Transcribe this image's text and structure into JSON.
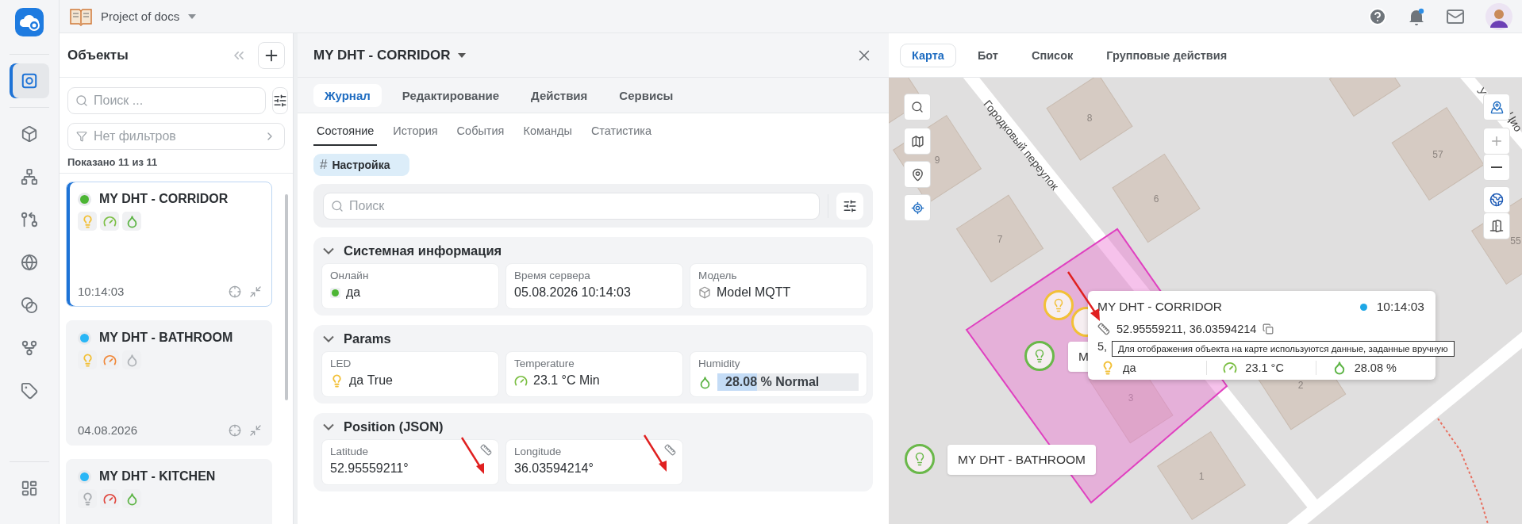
{
  "topbar": {
    "project": "Project of docs"
  },
  "rail": {
    "top": [
      {
        "selected": true
      }
    ],
    "main": [
      {
        "selected": false
      },
      {
        "selected": false
      },
      {
        "selected": false
      },
      {
        "selected": false
      },
      {
        "selected": false
      },
      {
        "selected": false
      },
      {
        "selected": false
      }
    ],
    "bottom": [
      {
        "selected": false
      }
    ]
  },
  "objects_panel": {
    "title": "Объекты",
    "search": {
      "placeholder": "Поиск ..."
    },
    "filter": "Нет фильтров",
    "count": "Показано 11 из 11",
    "items": [
      {
        "name": "MY DHT - CORRIDOR",
        "color": "#4cb534",
        "selected": true,
        "time": "10:14:03",
        "sensors": [
          {
            "kind": "led",
            "color": "#f2c037"
          },
          {
            "kind": "gauge",
            "color": "#7cbf45"
          },
          {
            "kind": "drop",
            "color": "#5fb548"
          }
        ]
      },
      {
        "name": "MY DHT - BATHROOM",
        "color": "#29b6f6",
        "selected": false,
        "time": "04.08.2026",
        "sensors": [
          {
            "kind": "led",
            "color": "#f2c037"
          },
          {
            "kind": "gauge",
            "color": "#f0883a"
          },
          {
            "kind": "drop",
            "color": "#b0b4b8"
          }
        ]
      },
      {
        "name": "MY DHT - KITCHEN",
        "color": "#29b6f6",
        "selected": false,
        "sensors": [
          {
            "kind": "led",
            "color": "#a8acb0"
          },
          {
            "kind": "gauge",
            "color": "#e0463e"
          },
          {
            "kind": "drop",
            "color": "#5fb548"
          }
        ]
      }
    ]
  },
  "detail": {
    "title": "MY DHT - CORRIDOR",
    "tabs": [
      {
        "label": "Журнал",
        "selected": true
      },
      {
        "label": "Редактирование",
        "selected": false
      },
      {
        "label": "Действия",
        "selected": false
      },
      {
        "label": "Сервисы",
        "selected": false
      }
    ],
    "subtabs": [
      {
        "label": "Состояние",
        "selected": true
      },
      {
        "label": "История",
        "selected": false
      },
      {
        "label": "События",
        "selected": false
      },
      {
        "label": "Команды",
        "selected": false
      },
      {
        "label": "Статистика",
        "selected": false
      }
    ],
    "tag": {
      "symbol": "#",
      "label": "Настройка"
    },
    "search": {
      "placeholder": "Поиск"
    },
    "sections": [
      {
        "title": "Системная информация",
        "expanded": true,
        "fields": [
          {
            "kind": "status",
            "label": "Онлайн",
            "value": "да",
            "color": "#4cb534"
          },
          {
            "kind": "text",
            "label": "Время сервера",
            "value": "05.08.2026 10:14:03"
          },
          {
            "kind": "model",
            "label": "Модель",
            "value": "Model MQTT"
          }
        ]
      },
      {
        "title": "Params",
        "expanded": true,
        "fields": [
          {
            "kind": "led",
            "label": "LED",
            "value": "да True",
            "color": "#f2c037"
          },
          {
            "kind": "gauge",
            "label": "Temperature",
            "value": "23.1 °C Min",
            "color": "#7cbf45"
          },
          {
            "kind": "meter",
            "label": "Humidity",
            "value": "28.08 % Normal",
            "color": "#5fb548",
            "level": 0.28
          }
        ]
      },
      {
        "title": "Position (JSON)",
        "expanded": true,
        "fields": [
          {
            "kind": "manual",
            "label": "Latitude",
            "value": "52.95559211°"
          },
          {
            "kind": "manual",
            "label": "Longitude",
            "value": "36.03594214°"
          }
        ]
      }
    ]
  },
  "map": {
    "tabs": [
      {
        "label": "Карта",
        "selected": true
      },
      {
        "label": "Бот",
        "selected": false
      },
      {
        "label": "Список",
        "selected": false
      },
      {
        "label": "Групповые действия",
        "selected": false
      }
    ],
    "streets": [
      {
        "text": "Городковый переулок"
      },
      {
        "text": "У"
      },
      {
        "text": "Цио"
      }
    ],
    "buildings": [
      {
        "number": "8"
      },
      {
        "number": "9"
      },
      {
        "number": "6"
      },
      {
        "number": "7"
      },
      {
        "number": "57"
      },
      {
        "number": "55"
      },
      {
        "number": "3"
      },
      {
        "number": "2"
      },
      {
        "number": "1"
      }
    ],
    "markers": [
      {
        "color": "#f2c037"
      },
      {
        "color": "#f2c037"
      },
      {
        "color": "#6ab84a",
        "label": "M"
      },
      {
        "color": "#6ab84a",
        "label": "MY DHT - BATHROOM"
      }
    ],
    "popup": {
      "title": "MY DHT - CORRIDOR",
      "color": "#1ea7e6",
      "time": "10:14:03",
      "coords": "52.95559211, 36.03594214",
      "partial": "5,",
      "values": [
        {
          "kind": "led",
          "color": "#f2c037",
          "value": "да"
        },
        {
          "kind": "gauge",
          "color": "#7cbf45",
          "value": "23.1 °C"
        },
        {
          "kind": "drop",
          "color": "#5fb548",
          "value": "28.08 %"
        }
      ]
    },
    "tooltip": "Для отображения объекта на карте используются данные, заданные вручную"
  }
}
